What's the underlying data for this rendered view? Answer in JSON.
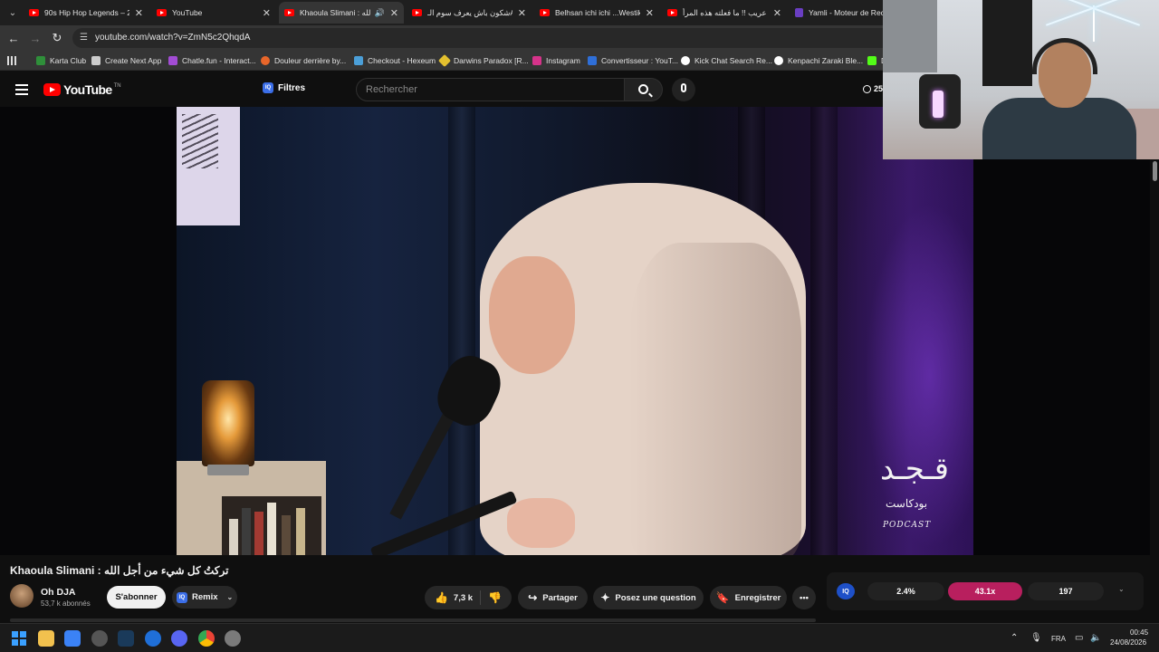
{
  "browser": {
    "tabs": [
      {
        "title": "90s Hip Hop Legends – 2P",
        "active": false,
        "favicon": "youtube-icon"
      },
      {
        "title": "YouTube",
        "active": false,
        "favicon": "youtube-icon"
      },
      {
        "title": "Khaoula Slimani : الله",
        "active": true,
        "favicon": "youtube-icon",
        "audio": true
      },
      {
        "title": "شكون باش يعرف سوم الـA",
        "active": false,
        "favicon": "youtube-icon"
      },
      {
        "title": "Belhsan ichi ichi ...Westik",
        "active": false,
        "favicon": "youtube-icon"
      },
      {
        "title": "عريب !! ما فعلته هذه المرأ",
        "active": false,
        "favicon": "youtube-icon"
      },
      {
        "title": "Yamli - Moteur de Rech",
        "active": false,
        "favicon": "yamli-icon"
      }
    ],
    "url": "youtube.com/watch?v=ZmN5c2QhqdA",
    "bookmarks": [
      {
        "label": "Karta Club",
        "color": "#2f8f3a"
      },
      {
        "label": "Create Next App",
        "color": "#cccccc"
      },
      {
        "label": "Chatle.fun - Interact...",
        "color": "#a24cd4"
      },
      {
        "label": "Douleur derrière by...",
        "color": "#e8662a"
      },
      {
        "label": "Checkout - Hexeum",
        "color": "#4b9fd8"
      },
      {
        "label": "Darwins Paradox [R...",
        "color": "#e3c02f"
      },
      {
        "label": "Instagram",
        "color": "#d6338a"
      },
      {
        "label": "Convertisseur : YouT...",
        "color": "#2f6fd8"
      },
      {
        "label": "Kick Chat Search Re...",
        "color": "#ffffff"
      },
      {
        "label": "Kenpachi Zaraki Ble...",
        "color": "#ffffff"
      },
      {
        "label": "D",
        "color": "#53fc18"
      }
    ]
  },
  "youtube": {
    "logo_text": "YouTube",
    "logo_suffix": "TN",
    "filters_label": "Filtres",
    "search_placeholder": "Rechercher",
    "header_badge": "25",
    "video": {
      "podcast_arabic": "قـجـد",
      "podcast_arabic_small": "بودكاست",
      "podcast_latin": "PODCAST"
    },
    "title": "Khaoula Slimani : تركتُ كل شيء من أجل الله",
    "channel": {
      "name": "Oh DJA",
      "subscribers": "53,7 k abonnés"
    },
    "subscribe_label": "S'abonner",
    "remix_label": "Remix",
    "likes": "7,3 k",
    "share_label": "Partager",
    "ask_label": "Posez une question",
    "save_label": "Enregistrer",
    "stats": {
      "a": "2.4%",
      "b": "43.1x",
      "c": "197"
    }
  },
  "taskbar": {
    "language": "FRA",
    "time": "00:45",
    "date": "24/08/2026"
  }
}
